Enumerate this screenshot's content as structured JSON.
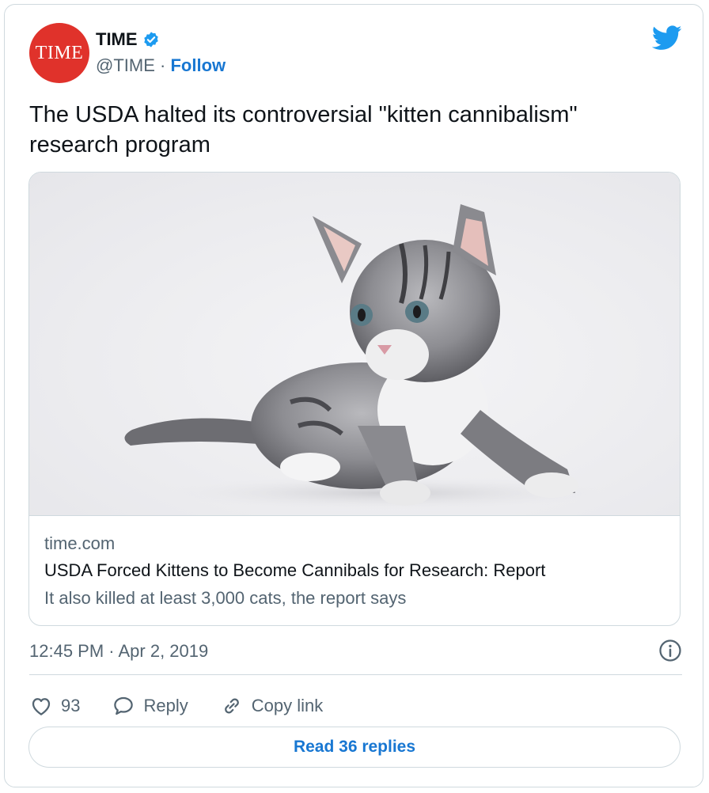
{
  "author": {
    "avatar_text": "TIME",
    "name": "TIME",
    "handle": "@TIME",
    "separator": "·",
    "follow_label": "Follow"
  },
  "tweet": {
    "text": "The USDA halted its controversial \"kitten cannibalism\" research program",
    "timestamp": "12:45 PM · Apr 2, 2019"
  },
  "card": {
    "image_icon": "kitten-photo",
    "domain": "time.com",
    "title": "USDA Forced Kittens to Become Cannibals for Research: Report",
    "description": "It also killed at least 3,000 cats, the report says"
  },
  "actions": {
    "likes_count": "93",
    "reply_label": "Reply",
    "copy_link_label": "Copy link",
    "read_replies_label": "Read 36 replies"
  },
  "colors": {
    "brand_red": "#e0322b",
    "link_blue": "#1877d2",
    "twitter_blue": "#1d9bf0",
    "secondary_text": "#536471"
  }
}
